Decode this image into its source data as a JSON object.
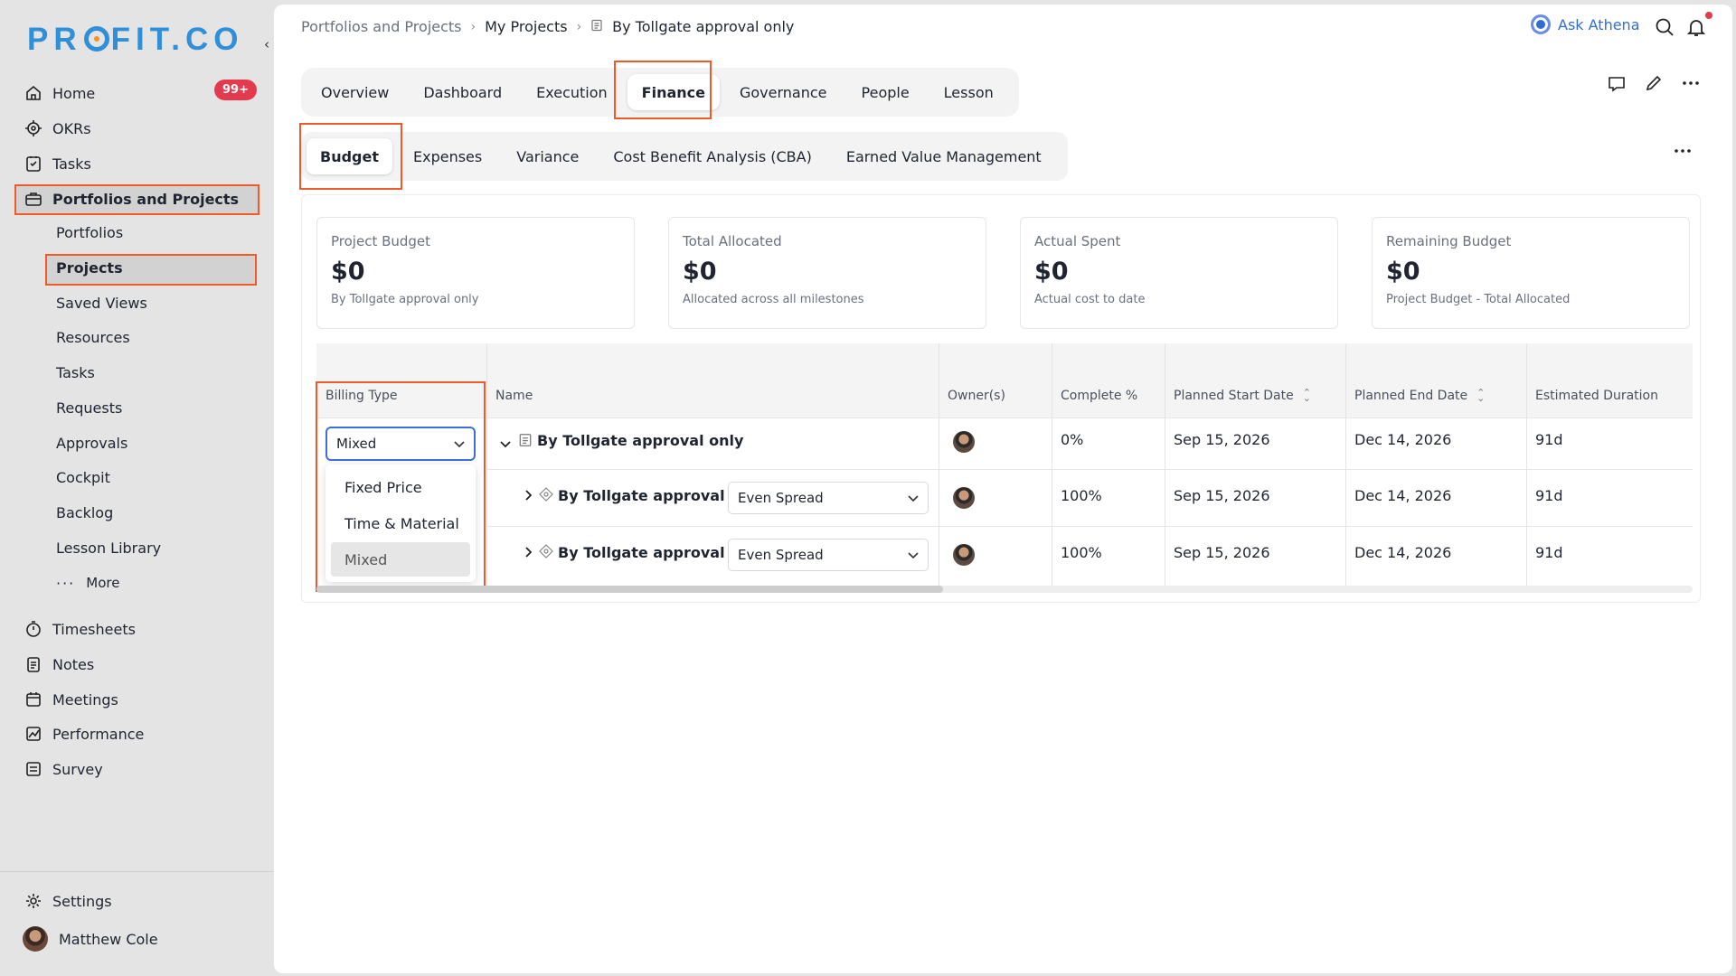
{
  "app": {
    "logo": "PROFIT.CO"
  },
  "sidebar": {
    "items": [
      {
        "label": "Home",
        "icon": "home-icon"
      },
      {
        "label": "OKRs",
        "icon": "target-icon"
      },
      {
        "label": "Tasks",
        "icon": "task-icon"
      },
      {
        "label": "Portfolios and Projects",
        "icon": "briefcase-icon"
      }
    ],
    "home_badge": "99+",
    "sub_items": [
      "Portfolios",
      "Projects",
      "Saved Views",
      "Resources",
      "Tasks",
      "Requests",
      "Approvals",
      "Cockpit",
      "Backlog",
      "Lesson Library",
      "More"
    ],
    "bottom_items": [
      {
        "label": "Timesheets",
        "icon": "stopwatch-icon"
      },
      {
        "label": "Notes",
        "icon": "notes-icon"
      },
      {
        "label": "Meetings",
        "icon": "calendar-icon"
      },
      {
        "label": "Performance",
        "icon": "chart-icon"
      },
      {
        "label": "Survey",
        "icon": "survey-icon"
      }
    ],
    "settings": "Settings",
    "user": "Matthew Cole"
  },
  "breadcrumb": [
    "Portfolios and Projects",
    "My Projects",
    "By Tollgate approval only"
  ],
  "header": {
    "ask_athena": "Ask Athena"
  },
  "tabs": [
    "Overview",
    "Dashboard",
    "Execution",
    "Finance",
    "Governance",
    "People",
    "Lesson"
  ],
  "active_tab": "Finance",
  "subtabs": [
    "Budget",
    "Expenses",
    "Variance",
    "Cost Benefit Analysis (CBA)",
    "Earned Value Management"
  ],
  "active_subtab": "Budget",
  "cards": [
    {
      "label": "Project Budget",
      "value": "$0",
      "sub": "By Tollgate approval only"
    },
    {
      "label": "Total Allocated",
      "value": "$0",
      "sub": "Allocated across all milestones"
    },
    {
      "label": "Actual Spent",
      "value": "$0",
      "sub": "Actual cost to date"
    },
    {
      "label": "Remaining Budget",
      "value": "$0",
      "sub": "Project Budget - Total Allocated"
    }
  ],
  "table": {
    "headers": [
      "Billing Type",
      "Name",
      "Owner(s)",
      "Complete %",
      "Planned Start Date",
      "Planned End Date",
      "Estimated Duration"
    ],
    "billing_value": "Mixed",
    "billing_options": [
      "Fixed Price",
      "Time & Material",
      "Mixed"
    ],
    "rows": [
      {
        "name": "By Tollgate approval only",
        "spread": "",
        "complete": "0%",
        "start": "Sep 15, 2026",
        "end": "Dec 14, 2026",
        "duration": "91d"
      },
      {
        "name": "By Tollgate approval ...",
        "spread": "Even Spread",
        "complete": "100%",
        "start": "Sep 15, 2026",
        "end": "Dec 14, 2026",
        "duration": "91d"
      },
      {
        "name": "By Tollgate approval ...",
        "spread": "Even Spread",
        "complete": "100%",
        "start": "Sep 15, 2026",
        "end": "Dec 14, 2026",
        "duration": "91d"
      }
    ]
  },
  "colors": {
    "accent": "#2f8fd9",
    "highlight": "#f05a28",
    "badge": "#e33a4d",
    "link": "#2f6fd0"
  }
}
